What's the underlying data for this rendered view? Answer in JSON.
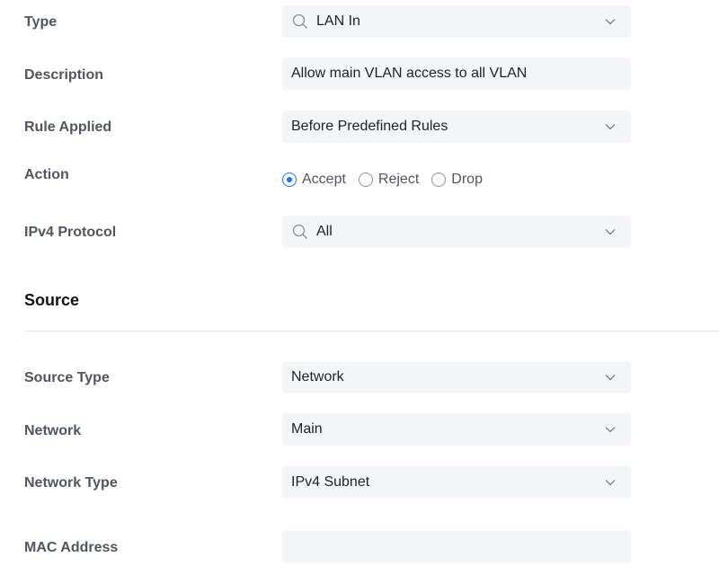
{
  "form": {
    "type": {
      "label": "Type",
      "value": "LAN In"
    },
    "description": {
      "label": "Description",
      "value": "Allow main VLAN access to all VLAN"
    },
    "rule_applied": {
      "label": "Rule Applied",
      "value": "Before Predefined Rules"
    },
    "action": {
      "label": "Action",
      "options": [
        "Accept",
        "Reject",
        "Drop"
      ],
      "selected": "Accept"
    },
    "ipv4_protocol": {
      "label": "IPv4 Protocol",
      "value": "All"
    }
  },
  "source": {
    "title": "Source",
    "source_type": {
      "label": "Source Type",
      "value": "Network"
    },
    "network": {
      "label": "Network",
      "value": "Main"
    },
    "network_type": {
      "label": "Network Type",
      "value": "IPv4 Subnet"
    },
    "mac_address": {
      "label": "MAC Address",
      "value": ""
    }
  },
  "colors": {
    "accent": "#1a73e8",
    "field_bg": "#f4f5f6",
    "label_text": "#50565e",
    "value_text": "#212327"
  },
  "icons": {
    "search": "search-icon",
    "dropdown": "chevron-down-icon"
  }
}
